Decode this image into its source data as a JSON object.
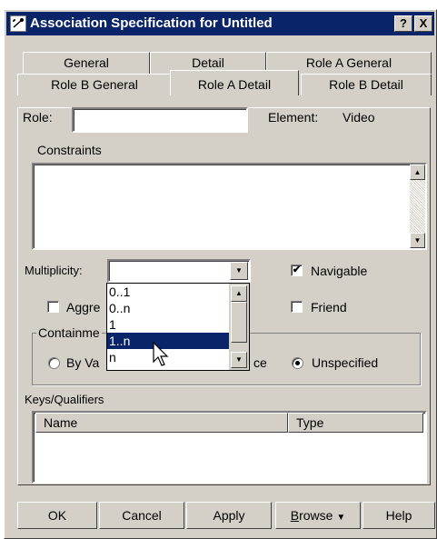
{
  "window": {
    "title": "Association Specification for Untitled",
    "help_label": "?",
    "close_label": "X"
  },
  "tabs": {
    "row1": [
      {
        "label": "General"
      },
      {
        "label": "Detail"
      },
      {
        "label": "Role A General"
      }
    ],
    "row2": [
      {
        "label": "Role B General"
      },
      {
        "label": "Role A Detail"
      },
      {
        "label": "Role B Detail"
      }
    ],
    "active": "Role A Detail"
  },
  "form": {
    "role_label": "Role:",
    "role_value": "",
    "element_label": "Element:",
    "element_value": "Video",
    "constraints_label": "Constraints",
    "constraints_value": "",
    "multiplicity_label": "Multiplicity:",
    "multiplicity_value": "",
    "navigable_label": "Navigable",
    "navigable_checked": true,
    "aggregate_label": "Aggre",
    "aggregate_checked": false,
    "friend_label": "Friend",
    "friend_checked": false,
    "containment_label": "Containme",
    "by_value_label": "By Va",
    "by_reference_label": "ce",
    "unspecified_label": "Unspecified",
    "containment_selected": "Unspecified",
    "keys_label": "Keys/Qualifiers",
    "keys_columns": [
      "Name",
      "Type"
    ]
  },
  "multiplicity_options": [
    {
      "label": "0..1"
    },
    {
      "label": "0..n"
    },
    {
      "label": "1"
    },
    {
      "label": "1..n"
    },
    {
      "label": "n"
    }
  ],
  "multiplicity_highlighted": "1..n",
  "buttons": {
    "ok": "OK",
    "cancel": "Cancel",
    "apply": "Apply",
    "browse_first": "B",
    "browse_rest": "rowse",
    "browse_arrow": "▼",
    "help": "Help"
  },
  "icons": {
    "app": "association-icon",
    "scroll_up": "▲",
    "scroll_down": "▼",
    "dropdown": "▼",
    "check": "✔"
  }
}
